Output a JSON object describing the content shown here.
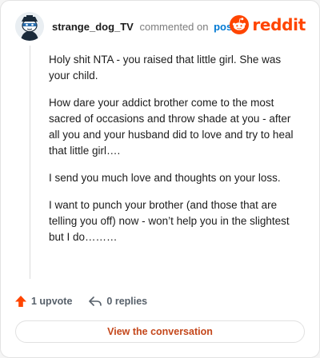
{
  "header": {
    "username": "strange_dog_TV",
    "commented_text": "commented on",
    "post_link": "post",
    "brand_name": "reddit"
  },
  "comment": {
    "paragraphs": [
      "Holy shit NTA - you raised that little girl. She was your child.",
      "How dare your addict brother come to the most sacred of occasions and throw shade at you - after all you and your husband did to love and try to heal that little girl….",
      "I send you much love and thoughts on your loss.",
      "I want to punch your brother (and those that are telling you off) now - won’t help you in the slightest but I do………"
    ]
  },
  "actions": {
    "upvote_label": "1 upvote",
    "replies_label": "0 replies"
  },
  "footer": {
    "view_button_label": "View the conversation"
  },
  "colors": {
    "brand": "#ff4500",
    "link": "#0079d3",
    "button_text": "#c4471b"
  },
  "icons": {
    "avatar": "snoo-avatar",
    "brand": "reddit-snoo-icon",
    "upvote": "upvote-arrow-icon",
    "reply": "reply-arrow-icon"
  }
}
